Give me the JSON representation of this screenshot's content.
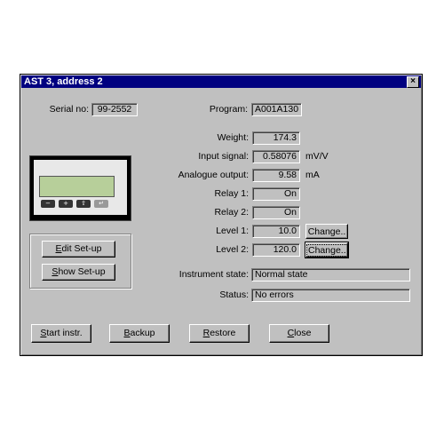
{
  "window": {
    "title": "AST 3, address 2",
    "close_glyph": "×"
  },
  "info": {
    "serial_label": "Serial no:",
    "serial_value": "99-2552",
    "program_label": "Program:",
    "program_value": "A001A130"
  },
  "readings": {
    "weight_label": "Weight:",
    "weight_value": "174.3",
    "input_label": "Input signal:",
    "input_value": "0.58076",
    "input_unit": "mV/V",
    "analogue_label": "Analogue output:",
    "analogue_value": "9.58",
    "analogue_unit": "mA",
    "relay1_label": "Relay 1:",
    "relay1_value": "On",
    "relay2_label": "Relay 2:",
    "relay2_value": "On",
    "level1_label": "Level 1:",
    "level1_value": "10.0",
    "level1_button": "Change..",
    "level2_label": "Level 2:",
    "level2_value": "120.0",
    "level2_button": "Change.."
  },
  "state": {
    "instrument_label": "Instrument state:",
    "instrument_value": "Normal state",
    "status_label": "Status:",
    "status_value": "No errors"
  },
  "device_keys": [
    "−",
    "+",
    "⇧",
    "↵"
  ],
  "setup": {
    "edit": {
      "accel": "E",
      "rest": "dit Set-up"
    },
    "show": {
      "accel": "S",
      "rest": "how Set-up"
    }
  },
  "footer": {
    "start": {
      "accel": "S",
      "rest": "tart instr."
    },
    "backup": {
      "accel": "B",
      "rest": "ackup"
    },
    "restore": {
      "accel": "R",
      "rest": "estore"
    },
    "close": {
      "accel": "C",
      "rest": "lose"
    }
  }
}
